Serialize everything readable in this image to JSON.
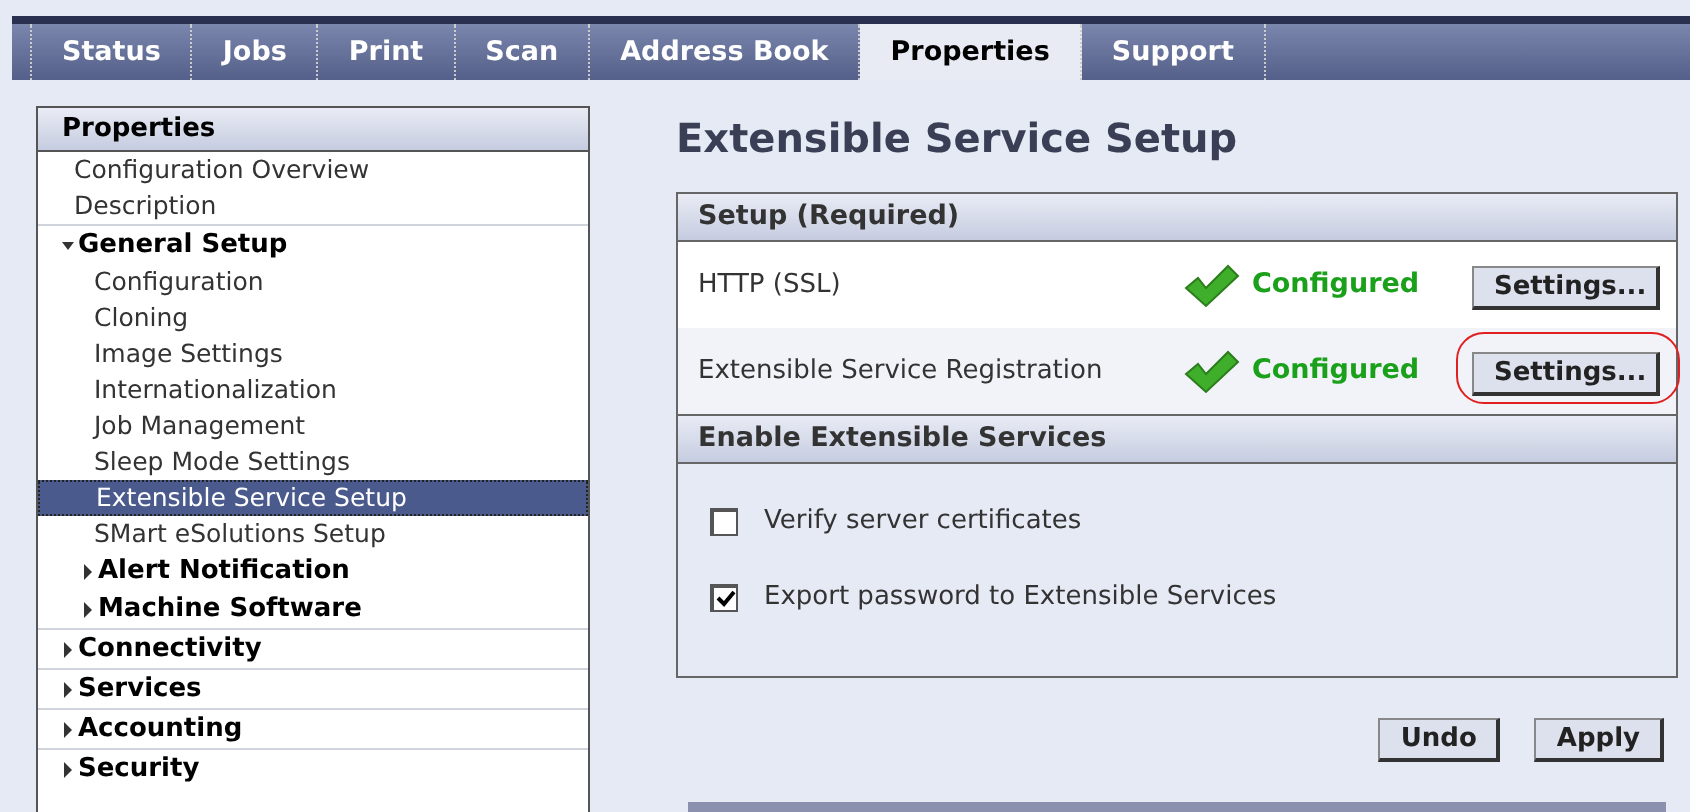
{
  "tabs": [
    {
      "label": "Status",
      "selected": false
    },
    {
      "label": "Jobs",
      "selected": false
    },
    {
      "label": "Print",
      "selected": false
    },
    {
      "label": "Scan",
      "selected": false
    },
    {
      "label": "Address Book",
      "selected": false
    },
    {
      "label": "Properties",
      "selected": true
    },
    {
      "label": "Support",
      "selected": false
    }
  ],
  "sidebar": {
    "title": "Properties",
    "items": [
      {
        "label": "Configuration Overview",
        "kind": "leaf",
        "selected": false
      },
      {
        "label": "Description",
        "kind": "leaf",
        "selected": false
      },
      {
        "label": "General Setup",
        "kind": "group",
        "expanded": true,
        "children": [
          {
            "label": "Configuration",
            "kind": "leaf",
            "selected": false
          },
          {
            "label": "Cloning",
            "kind": "leaf",
            "selected": false
          },
          {
            "label": "Image Settings",
            "kind": "leaf",
            "selected": false
          },
          {
            "label": "Internationalization",
            "kind": "leaf",
            "selected": false
          },
          {
            "label": "Job Management",
            "kind": "leaf",
            "selected": false
          },
          {
            "label": "Sleep Mode Settings",
            "kind": "leaf",
            "selected": false
          },
          {
            "label": "Extensible Service Setup",
            "kind": "leaf",
            "selected": true
          },
          {
            "label": "SMart eSolutions Setup",
            "kind": "leaf",
            "selected": false
          },
          {
            "label": "Alert Notification",
            "kind": "group",
            "expanded": false
          },
          {
            "label": "Machine Software",
            "kind": "group",
            "expanded": false
          }
        ]
      },
      {
        "label": "Connectivity",
        "kind": "group",
        "expanded": false
      },
      {
        "label": "Services",
        "kind": "group",
        "expanded": false
      },
      {
        "label": "Accounting",
        "kind": "group",
        "expanded": false
      },
      {
        "label": "Security",
        "kind": "group",
        "expanded": false
      }
    ]
  },
  "page_title": "Extensible Service Setup",
  "setup": {
    "title": "Setup (Required)",
    "rows": [
      {
        "label": "HTTP (SSL)",
        "status": "Configured",
        "button": "Settings...",
        "highlighted": false
      },
      {
        "label": "Extensible Service Registration",
        "status": "Configured",
        "button": "Settings...",
        "highlighted": true
      }
    ]
  },
  "enable": {
    "title": "Enable Extensible Services",
    "options": [
      {
        "label": "Verify server certificates",
        "checked": false
      },
      {
        "label": "Export password to Extensible Services",
        "checked": true
      }
    ]
  },
  "buttons": [
    "Undo",
    "Apply"
  ]
}
